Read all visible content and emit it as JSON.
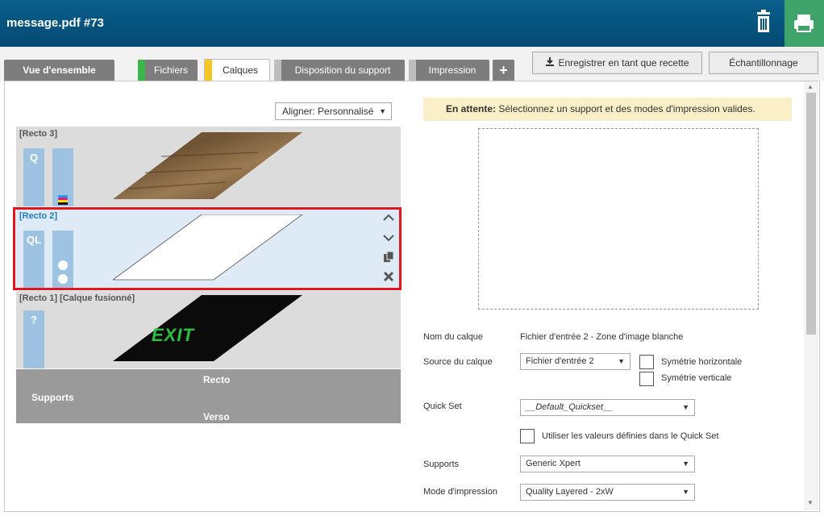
{
  "header": {
    "title": "message.pdf #73",
    "trash_icon": "trash-icon",
    "print_icon": "printer-icon",
    "accent": "#3ea46a",
    "bg": "#055580"
  },
  "tabs": [
    {
      "label": "Vue d'ensemble"
    },
    {
      "label": "Fichiers",
      "flag": "#3cb54a"
    },
    {
      "label": "Calques",
      "flag": "#f6c623",
      "active": true
    },
    {
      "label": "Disposition du support",
      "flag": "#bdbdbd"
    },
    {
      "label": "Impression",
      "flag": "#bdbdbd"
    },
    {
      "label": "+"
    }
  ],
  "toolbar": {
    "save_recipe_label": "Enregistrer en tant que recette",
    "sampling_label": "Échantillonnage"
  },
  "align": {
    "label": "Aligner: Personnalisé"
  },
  "layers": [
    {
      "title": "[Recto 3]",
      "bar1": "Q"
    },
    {
      "title": "[Recto 2]",
      "bar1": "QL",
      "selected": true
    },
    {
      "title": "[Recto 1] [Calque fusionné]",
      "bar1": "?",
      "image_text": "EXIT"
    }
  ],
  "supports": {
    "recto": "Recto",
    "label": "Supports",
    "verso": "Verso"
  },
  "status": {
    "prefix": "En attente:",
    "message": "Sélectionnez un support et des modes d'impression valides."
  },
  "form": {
    "layer_name_label": "Nom du calque",
    "layer_name_value": "Fichier d'entrée 2 - Zone d'image blanche",
    "layer_source_label": "Source du calque",
    "layer_source_value": "Fichier d'entrée 2",
    "flip_h_label": "Symétrie horizontale",
    "flip_v_label": "Symétrie verticale",
    "quickset_label": "Quick Set",
    "quickset_value": "__Default_Quickset__",
    "use_quickset_label": "Utiliser les valeurs définies dans le Quick Set",
    "supports_label": "Supports",
    "supports_value": "Generic Xpert",
    "print_mode_label": "Mode d'impression",
    "print_mode_value": "Quality Layered - 2xW"
  }
}
